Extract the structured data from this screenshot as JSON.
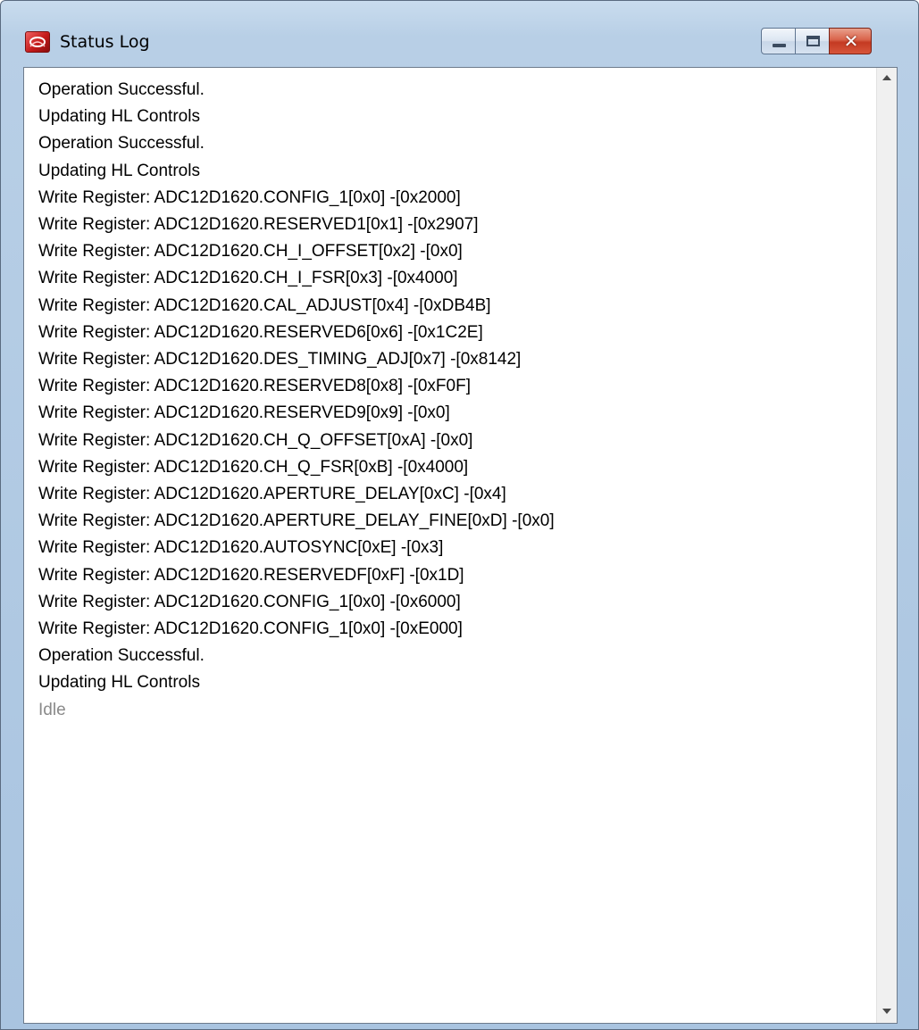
{
  "window": {
    "title": "Status Log"
  },
  "log": {
    "lines": [
      "Operation Successful.",
      "Updating HL Controls",
      "Operation Successful.",
      "Updating HL Controls",
      "Write Register: ADC12D1620.CONFIG_1[0x0] -[0x2000]",
      "Write Register: ADC12D1620.RESERVED1[0x1] -[0x2907]",
      "Write Register: ADC12D1620.CH_I_OFFSET[0x2] -[0x0]",
      "Write Register: ADC12D1620.CH_I_FSR[0x3] -[0x4000]",
      "Write Register: ADC12D1620.CAL_ADJUST[0x4] -[0xDB4B]",
      "Write Register: ADC12D1620.RESERVED6[0x6] -[0x1C2E]",
      "Write Register: ADC12D1620.DES_TIMING_ADJ[0x7] -[0x8142]",
      "Write Register: ADC12D1620.RESERVED8[0x8] -[0xF0F]",
      "Write Register: ADC12D1620.RESERVED9[0x9] -[0x0]",
      "Write Register: ADC12D1620.CH_Q_OFFSET[0xA] -[0x0]",
      "Write Register: ADC12D1620.CH_Q_FSR[0xB] -[0x4000]",
      "Write Register: ADC12D1620.APERTURE_DELAY[0xC] -[0x4]",
      "Write Register: ADC12D1620.APERTURE_DELAY_FINE[0xD] -[0x0]",
      "Write Register: ADC12D1620.AUTOSYNC[0xE] -[0x3]",
      "Write Register: ADC12D1620.RESERVEDF[0xF] -[0x1D]",
      "Write Register: ADC12D1620.CONFIG_1[0x0] -[0x6000]",
      "Write Register: ADC12D1620.CONFIG_1[0x0] -[0xE000]",
      "Operation Successful.",
      "Updating HL Controls"
    ],
    "status_line": "Idle"
  },
  "colors": {
    "title_bar": "#b8cfe6",
    "close_button": "#c43a22",
    "status_text": "#8a8a8a"
  },
  "icons": {
    "app": "app-logo-icon",
    "minimize": "minimize-icon",
    "maximize": "maximize-icon",
    "close": "close-icon",
    "scroll_up": "scroll-up-arrow-icon",
    "scroll_down": "scroll-down-arrow-icon"
  }
}
